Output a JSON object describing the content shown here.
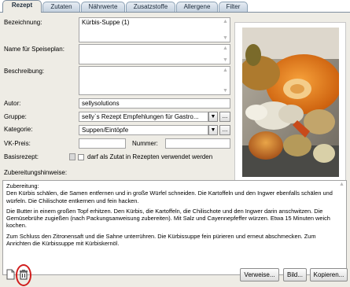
{
  "tabs": [
    {
      "label": "Rezept",
      "active": true
    },
    {
      "label": "Zutaten",
      "active": false
    },
    {
      "label": "Nährwerte",
      "active": false
    },
    {
      "label": "Zusatzstoffe",
      "active": false
    },
    {
      "label": "Allergene",
      "active": false
    },
    {
      "label": "Filter",
      "active": false
    }
  ],
  "form": {
    "bezeichnung_label": "Bezeichnung:",
    "bezeichnung_value": "Kürbis-Suppe (1)",
    "speiseplan_label": "Name für Speiseplan:",
    "speiseplan_value": "",
    "beschreibung_label": "Beschreibung:",
    "beschreibung_value": "",
    "autor_label": "Autor:",
    "autor_value": "sellysolutions",
    "gruppe_label": "Gruppe:",
    "gruppe_value": "selly`s  Rezept Empfehlungen für Gastro...",
    "kategorie_label": "Kategorie:",
    "kategorie_value": "Suppen/Eintöpfe",
    "vkpreis_label": "VK-Preis:",
    "vkpreis_value": "",
    "nummer_label": "Nummer:",
    "nummer_value": "",
    "basisrezept_label": "Basisrezept:",
    "basisrezept_checkbox_label": "darf als Zutat in Rezepten verwendet werden",
    "zubereitung_label": "Zubereitungshinweise:",
    "combo_arrow": "▼",
    "dots": "..."
  },
  "zubereitung_text": [
    "Zubereitung:\nDen Kürbis schälen, die Samen entfernen und in große Würfel schneiden. Die Kartoffeln und den Ingwer ebenfalls schälen und würfeln. Die Chilischote entkernen und fein hacken.",
    "Die Butter in einem großen Topf erhitzen. Den Kürbis, die Kartoffeln, die Chilischote und den Ingwer darin anschwitzen. Die Gemüsebrühe zugießen (nach Packungsanweisung zubereiten). Mit Salz und Cayennepfeffer würzen. Etwa 15 Minuten weich kochen.",
    "Zum Schluss den Zitronensaft und die Sahne unterrühren. Die Kürbissuppe fein pürieren und erneut abschmecken. Zum Anrichten die Kürbissuppe mit Kürbiskernöl."
  ],
  "buttons": {
    "verweise": "Verweise...",
    "bild": "Bild...",
    "kopieren": "Kopieren..."
  },
  "icons": {
    "new_document": "new-document-icon",
    "delete": "trash-icon",
    "scroll_up": "▲",
    "scroll_down": "▼"
  },
  "colors": {
    "panel_bg": "#eeece5",
    "highlight_circle": "#d11d1d"
  }
}
